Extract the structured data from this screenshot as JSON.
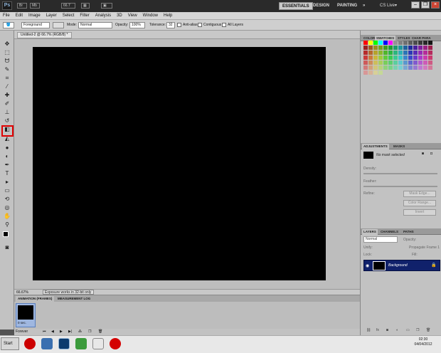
{
  "app": {
    "logo": "Ps",
    "zoom_dropdown": "66.7"
  },
  "workspaces": {
    "essentials": "ESSENTIALS",
    "design": "DESIGN",
    "painting": "PAINTING",
    "more": "»",
    "cslive": "CS Live▾"
  },
  "menu": [
    "File",
    "Edit",
    "Image",
    "Layer",
    "Select",
    "Filter",
    "Analysis",
    "3D",
    "View",
    "Window",
    "Help"
  ],
  "options": {
    "fill_source": "Foreground",
    "mode_label": "Mode:",
    "mode_value": "Normal",
    "opacity_label": "Opacity:",
    "opacity_value": "100%",
    "tolerance_label": "Tolerance:",
    "tolerance_value": "32",
    "antialias": "Anti-alias",
    "contiguous": "Contiguous",
    "all_layers": "All Layers"
  },
  "document": {
    "tab_title": "Untitled-2 @ 66.7% (RGB/8) *",
    "zoom_status": "66.67%",
    "status_msg": "Exposure works in 32-bit only"
  },
  "animation": {
    "tab_frames": "ANIMATION (FRAMES)",
    "tab_measure": "MEASUREMENT LOG",
    "frame_number": "1",
    "frame_delay": "0 sec.",
    "loop": "Forever"
  },
  "panels": {
    "swatches_tabs": [
      "COLOR",
      "SWATCHES",
      "STYLES",
      "CHAR PARA"
    ],
    "adjust_tabs": [
      "ADJUSTMENTS",
      "MASKS"
    ],
    "no_mask": "No mask selected",
    "density": "Density:",
    "feather": "Feather:",
    "refine": "Refine:",
    "btn_mask_edge": "Mask Edge...",
    "btn_color_range": "Color Range...",
    "btn_invert": "Invert",
    "layers_tabs": [
      "LAYERS",
      "CHANNELS",
      "PATHS"
    ],
    "blend": "Normal",
    "opacity": "Opacity:",
    "lock": "Lock:",
    "fill": "Fill:",
    "unify": "Unify:",
    "propagate": "Propagate Frame 1",
    "layer_name": "Background"
  },
  "taskbar": {
    "start": "Start",
    "time": "02:30",
    "date": "04/04/2012"
  },
  "colors": {
    "canvas": "#000000",
    "highlight": "#e00000",
    "layer_selected": "#10216b"
  }
}
